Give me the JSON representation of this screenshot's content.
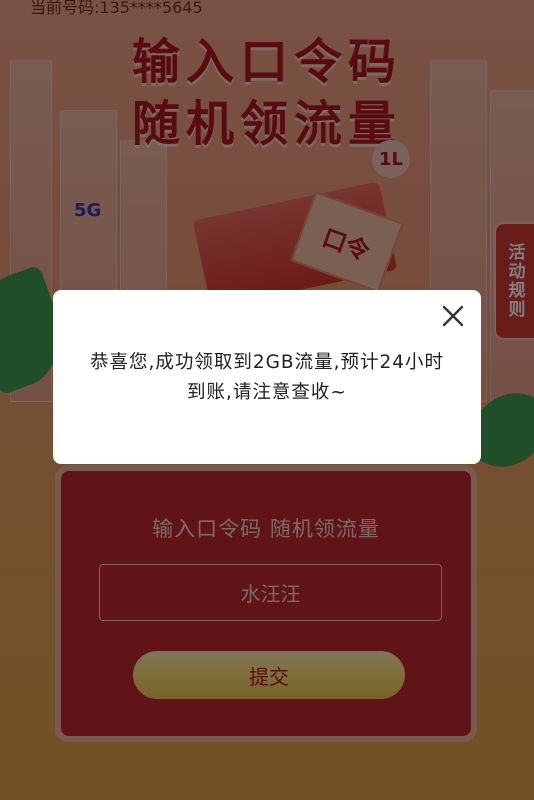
{
  "status_bar": {
    "text": "当前号码:135****5645"
  },
  "header": {
    "title_line1": "输入口令码",
    "title_line2": "随机领流量"
  },
  "decor": {
    "badge_1l": "1L",
    "label_5g": "5G",
    "coupon_text": "口令"
  },
  "side_tab": {
    "label": "活动规则"
  },
  "form": {
    "title": "输入口令码 随机领流量",
    "input_value": "水汪汪",
    "submit_label": "提交"
  },
  "modal": {
    "message": "恭喜您,成功领取到2GB流量,预计24小时到账,请注意查收~",
    "close_icon": "close-icon"
  },
  "colors": {
    "brand_red": "#b4161f",
    "button_gold": "#fde37e",
    "overlay": "rgba(0,0,0,0.5)"
  }
}
